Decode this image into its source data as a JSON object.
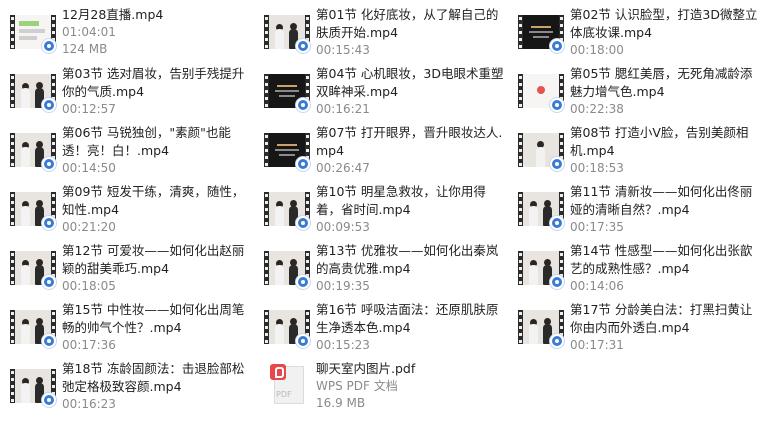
{
  "files": [
    {
      "name": "12月28直播.mp4",
      "line2": "01:04:01",
      "line3": "124 MB",
      "type": "video",
      "thumb": "chat"
    },
    {
      "name": "第01节 化好底妆，从了解自己的肤质开始.mp4",
      "line2": "00:15:43",
      "line3": "",
      "type": "video",
      "thumb": "duo"
    },
    {
      "name": "第02节  认识脸型，打造3D微整立体底妆课.mp4",
      "line2": "00:18:00",
      "line3": "",
      "type": "video",
      "thumb": "dark"
    },
    {
      "name": "第03节 选对眉妆，告别手残提升你的气质.mp4",
      "line2": "00:12:57",
      "line3": "",
      "type": "video",
      "thumb": "duo"
    },
    {
      "name": "第04节 心机眼妆，3D电眼术重塑双眸神采.mp4",
      "line2": "00:16:21",
      "line3": "",
      "type": "video",
      "thumb": "dark"
    },
    {
      "name": "第05节 腮红美唇，无死角减龄添魅力增气色.mp4",
      "line2": "00:22:38",
      "line3": "",
      "type": "video",
      "thumb": "white"
    },
    {
      "name": "第06节 马锐独创，\"素颜\"也能透！亮！白！.mp4",
      "line2": "00:14:50",
      "line3": "",
      "type": "video",
      "thumb": "duo"
    },
    {
      "name": "第07节 打开眼界，晋升眼妆达人.mp4",
      "line2": "00:26:47",
      "line3": "",
      "type": "video",
      "thumb": "dark"
    },
    {
      "name": "第08节 打造小V脸，告别美颜相机.mp4",
      "line2": "00:18:53",
      "line3": "",
      "type": "video",
      "thumb": "solo"
    },
    {
      "name": "第09节 短发干练，清爽，随性，知性.mp4",
      "line2": "00:21:20",
      "line3": "",
      "type": "video",
      "thumb": "duo"
    },
    {
      "name": "第10节 明星急救妆，让你用得着，省时间.mp4",
      "line2": "00:09:53",
      "line3": "",
      "type": "video",
      "thumb": "duo"
    },
    {
      "name": "第11节 清新妆——如何化出佟丽娅的清晰自然？.mp4",
      "line2": "00:17:35",
      "line3": "",
      "type": "video",
      "thumb": "duo"
    },
    {
      "name": "第12节 可爱妆——如何化出赵丽颖的甜美乖巧.mp4",
      "line2": "00:18:05",
      "line3": "",
      "type": "video",
      "thumb": "duo"
    },
    {
      "name": "第13节 优雅妆——如何化出秦岚的高贵优雅.mp4",
      "line2": "00:19:35",
      "line3": "",
      "type": "video",
      "thumb": "duo"
    },
    {
      "name": "第14节 性感型——如何化出张歆艺的成熟性感？.mp4",
      "line2": "00:14:06",
      "line3": "",
      "type": "video",
      "thumb": "duo"
    },
    {
      "name": "第15节 中性妆——如何化出周笔畅的帅气个性？.mp4",
      "line2": "00:17:36",
      "line3": "",
      "type": "video",
      "thumb": "duo"
    },
    {
      "name": "第16节 呼吸洁面法：还原肌肤原生净透本色.mp4",
      "line2": "00:15:23",
      "line3": "",
      "type": "video",
      "thumb": "duo"
    },
    {
      "name": "第17节 分龄美白法：打黑扫黄让你由内而外透白.mp4",
      "line2": "00:17:31",
      "line3": "",
      "type": "video",
      "thumb": "duo"
    },
    {
      "name": "第18节 冻龄固颜法：击退脸部松弛定格极致容颜.mp4",
      "line2": "00:16:23",
      "line3": "",
      "type": "video",
      "thumb": "duo"
    },
    {
      "name": "聊天室内图片.pdf",
      "line2": "WPS PDF 文档",
      "line3": "16.9 MB",
      "type": "pdf",
      "thumb": "pdf"
    }
  ],
  "icons": {
    "video": "video-file-icon",
    "pdf": "pdf-file-icon",
    "badge": "media-player-badge-icon"
  },
  "colors": {
    "name": "#222222",
    "meta": "#8a8a8a",
    "pdf_accent": "#e8484a",
    "badge": "#3a7bd5"
  }
}
